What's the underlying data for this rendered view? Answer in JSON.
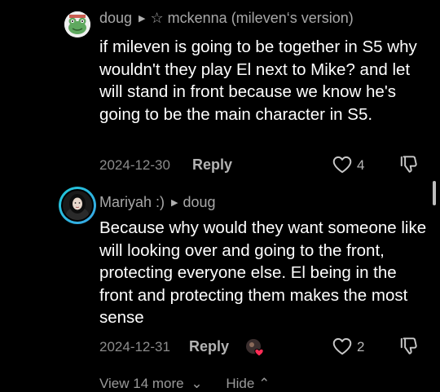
{
  "comments": [
    {
      "author": "doug",
      "reply_to": "☆ mckenna (mileven‘s version)",
      "text": "if mileven is going to be together in S5 why wouldn't they play El next to Mike? and let will stand in front because we know he's going to be the main character in S5.",
      "date": "2024-12-30",
      "reply_label": "Reply",
      "likes": "4",
      "avatar_icon": "frog-avatar"
    },
    {
      "author": "Mariyah :)",
      "reply_to": "doug",
      "text": "Because why would they want someone like will looking over and going to the front, protecting everyone else. El being in the front and protecting them makes the most sense",
      "date": "2024-12-31",
      "reply_label": "Reply",
      "likes": "2",
      "creator_liked": true,
      "avatar_icon": "portrait-avatar"
    }
  ],
  "footer": {
    "view_more": "View 14 more",
    "hide": "Hide"
  },
  "colors": {
    "background": "#000000",
    "text": "#ffffff",
    "muted": "#a8a8a8",
    "accent_ring": "#1fc8d8",
    "heart_red": "#fe2c55"
  }
}
